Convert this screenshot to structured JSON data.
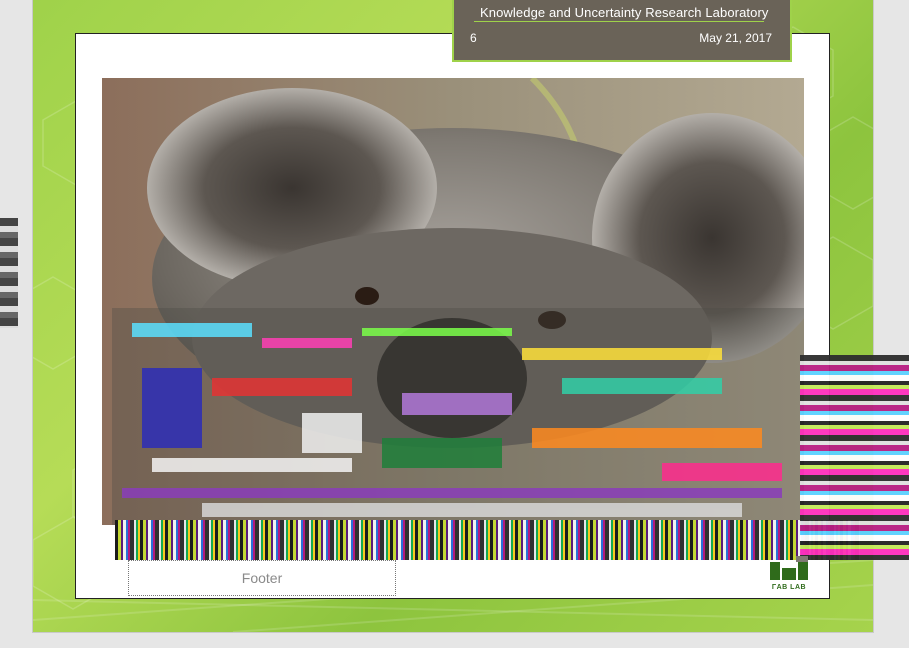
{
  "header": {
    "lab_name": "Knowledge and Uncertainty Research Laboratory",
    "slide_number": "6",
    "date": "May 21, 2017"
  },
  "slide": {
    "image_subject": "koala-photo",
    "footer_placeholder": "Footer"
  },
  "logo": {
    "text": "ΓAB LAB"
  },
  "colors": {
    "slide_green": "#9fd24a",
    "banner_brown": "#6a6358",
    "logo_green": "#2f6b1b"
  }
}
